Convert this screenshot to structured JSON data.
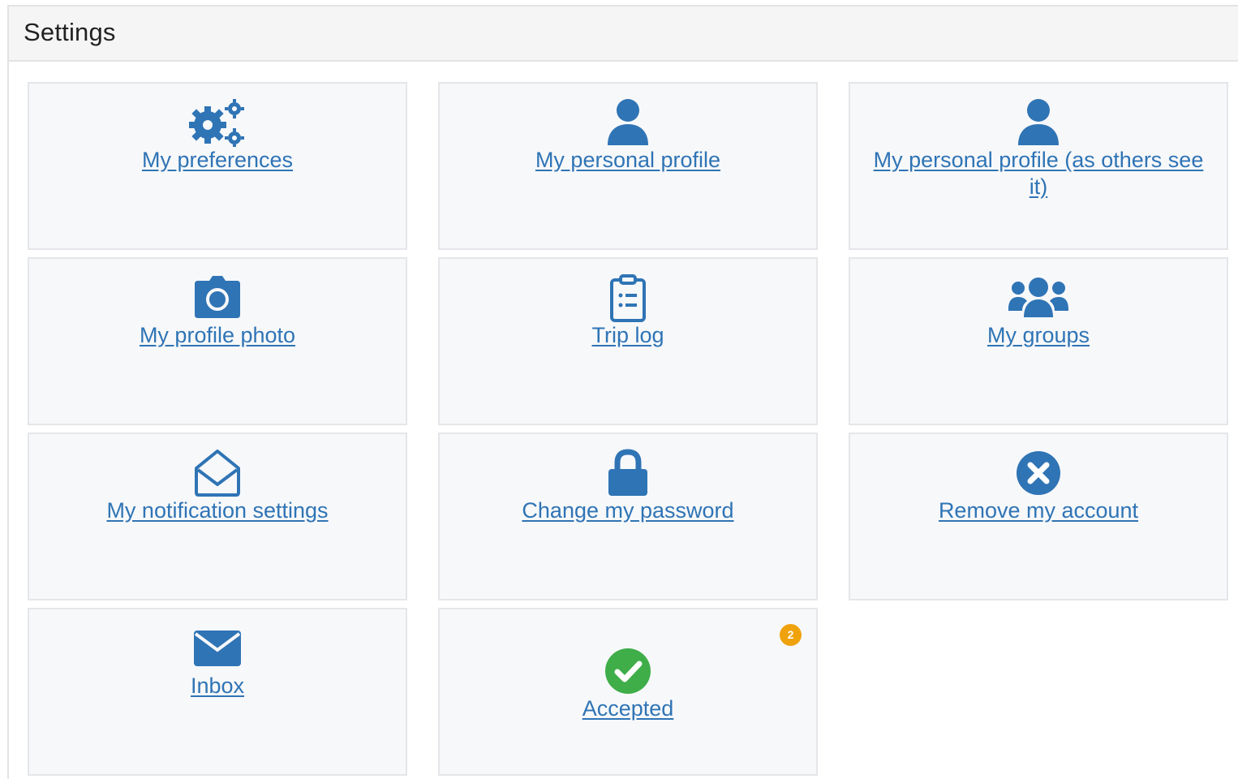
{
  "header": {
    "title": "Settings"
  },
  "tiles": [
    {
      "label": "My preferences",
      "icon": "gears-icon"
    },
    {
      "label": "My personal profile",
      "icon": "user-icon"
    },
    {
      "label": "My personal profile (as others see it)",
      "icon": "user-icon"
    },
    {
      "label": "My profile photo",
      "icon": "camera-icon"
    },
    {
      "label": "Trip log",
      "icon": "clipboard-list-icon"
    },
    {
      "label": "My groups",
      "icon": "users-icon"
    },
    {
      "label": "My notification settings",
      "icon": "envelope-open-icon"
    },
    {
      "label": "Change my password",
      "icon": "lock-icon"
    },
    {
      "label": "Remove my account",
      "icon": "times-circle-icon"
    },
    {
      "label": "Inbox",
      "icon": "envelope-icon"
    },
    {
      "label": "Accepted",
      "icon": "check-circle-icon",
      "badge": "2"
    }
  ],
  "colors": {
    "link": "#2f74b5",
    "icon": "#2f74b5",
    "accepted_icon": "#3fae49",
    "badge": "#f0a20c",
    "tile_bg": "#f7f8fa",
    "header_bg": "#f5f5f5"
  }
}
